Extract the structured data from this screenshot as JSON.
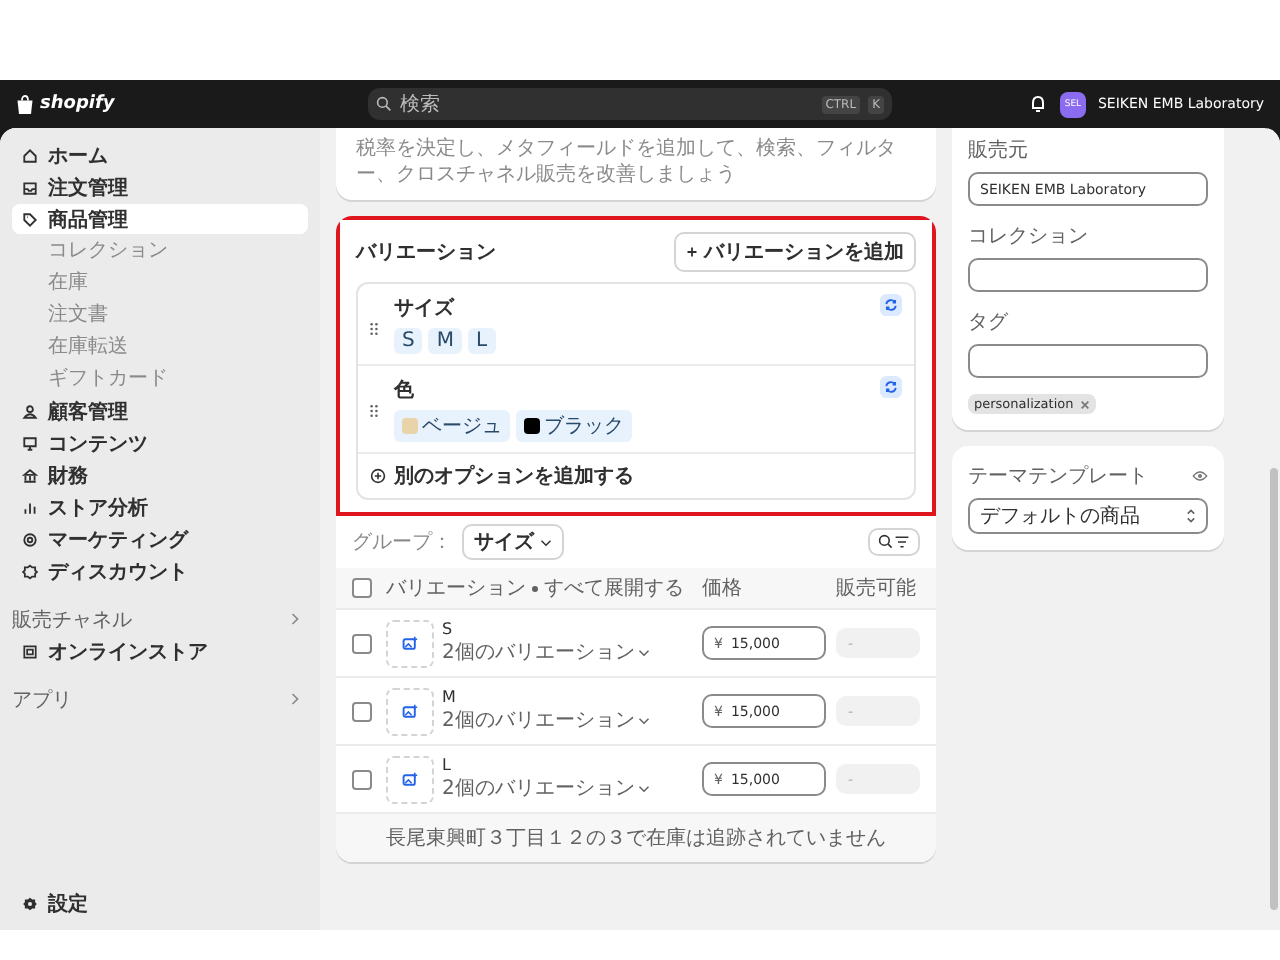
{
  "top_bar": {
    "logo": "shopify",
    "search": {
      "placeholder": "検索",
      "shortcut": [
        "CTRL",
        "K"
      ]
    },
    "avatar": "SEL",
    "store_name": "SEIKEN EMB Laboratory"
  },
  "sidebar": {
    "items": [
      {
        "label": "ホーム",
        "selected": false
      },
      {
        "label": "注文管理",
        "selected": false
      },
      {
        "label": "商品管理",
        "selected": true,
        "children": [
          {
            "label": "コレクション",
            "selected": false
          },
          {
            "label": "在庫",
            "selected": false
          },
          {
            "label": "注文書",
            "selected": false
          },
          {
            "label": "在庫転送",
            "selected": false
          },
          {
            "label": "ギフトカード",
            "selected": false
          }
        ]
      },
      {
        "label": "顧客管理",
        "selected": false
      },
      {
        "label": "コンテンツ",
        "selected": false
      },
      {
        "label": "財務",
        "selected": false
      },
      {
        "label": "ストア分析",
        "selected": false
      },
      {
        "label": "マーケティング",
        "selected": false
      },
      {
        "label": "ディスカウント",
        "selected": false
      }
    ],
    "sections": [
      {
        "title": "販売チャネル",
        "items": [
          {
            "label": "オンラインストア",
            "selected": false
          }
        ]
      },
      {
        "title": "アプリ"
      }
    ],
    "footer_item": "設定"
  },
  "intro_text": "税率を決定し、メタフィールドを追加して、検索、フィルター、クロスチャネル販売を改善しましょう",
  "variations": {
    "highlighted": true,
    "title": "バリエーション",
    "add_button": "バリエーションを追加",
    "options": [
      {
        "name": "サイズ",
        "values": [
          {
            "label": "S"
          },
          {
            "label": "M"
          },
          {
            "label": "L"
          }
        ]
      },
      {
        "name": "色",
        "values": [
          {
            "label": "ベージュ",
            "color": "#e8d4a8"
          },
          {
            "label": "ブラック",
            "color": "#000000"
          }
        ]
      }
    ],
    "add_option": "別のオプションを追加する"
  },
  "group_by": {
    "label": "グループ：",
    "value": "サイズ"
  },
  "table": {
    "header_checked": false,
    "columns": [
      "バリエーション",
      "価格",
      "販売可能"
    ],
    "expand_all": "すべて展開する",
    "rows": [
      {
        "checked": false,
        "name": "S",
        "variants": "2個のバリエーション",
        "currency": "¥",
        "price": "15,000",
        "available": "-"
      },
      {
        "checked": false,
        "name": "M",
        "variants": "2個のバリエーション",
        "currency": "¥",
        "price": "15,000",
        "available": "-"
      },
      {
        "checked": false,
        "name": "L",
        "variants": "2個のバリエーション",
        "currency": "¥",
        "price": "15,000",
        "available": "-"
      }
    ],
    "footer_note": "長尾東興町３丁目１２の３で在庫は追跡されていません"
  },
  "organization": {
    "vendor_label": "販売元",
    "vendor_value": "SEIKEN EMB Laboratory",
    "collection_label": "コレクション",
    "tag_label": "タグ",
    "tags": [
      "personalization"
    ]
  },
  "theme_template": {
    "label": "テーマテンプレート",
    "value": "デフォルトの商品"
  }
}
